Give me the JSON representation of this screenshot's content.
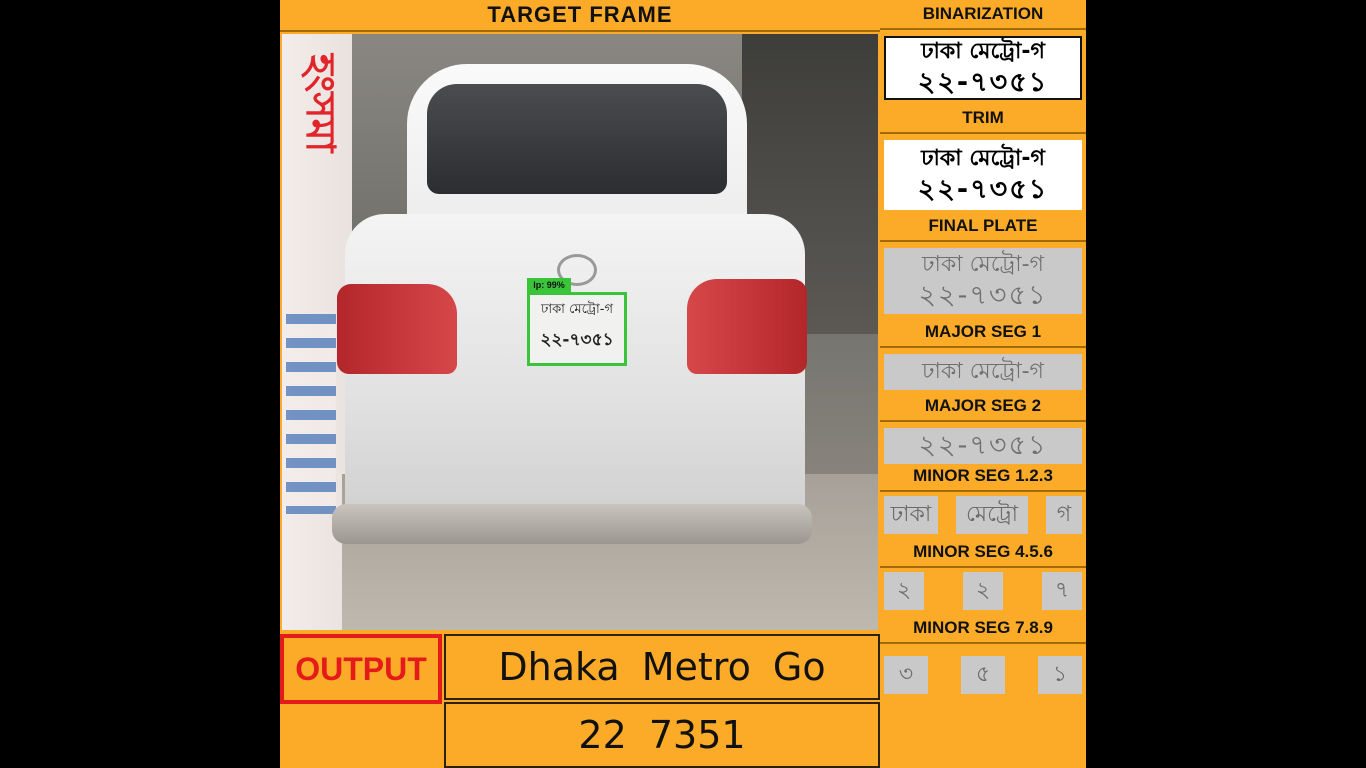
{
  "headers": {
    "target_frame": "TARGET  FRAME",
    "binarization": "BINARIZATION",
    "trim": "TRIM",
    "final_plate": "FINAL PLATE",
    "major_seg_1": "MAJOR SEG 1",
    "major_seg_2": "MAJOR SEG 2",
    "minor_seg_123": "MINOR SEG 1.2.3",
    "minor_seg_456": "MINOR SEG 4.5.6",
    "minor_seg_789": "MINOR SEG 7.8.9"
  },
  "frame": {
    "detect_tag": "lp: 99%",
    "plate_line1": "ঢাকা মেট্রো-গ",
    "plate_line2": "২২-৭৩৫১",
    "wall_text": "হংসমা"
  },
  "plates": {
    "binarization": {
      "line1": "ঢাকা মেট্রো-গ",
      "line2": "২২-৭৩৫১"
    },
    "trim": {
      "line1": "ঢাকা মেট্রো-গ",
      "line2": "২২-৭৩৫১"
    },
    "final": {
      "line1": "ঢাকা মেট্রো-গ",
      "line2": "২২-৭৩৫১"
    },
    "major_seg_1": "ঢাকা মেট্রো-গ",
    "major_seg_2": "২২-৭৩৫১"
  },
  "minor_segments": {
    "seg_123": [
      "ঢাকা",
      "মেট্রো",
      "গ"
    ],
    "seg_456": [
      "২",
      "২",
      "৭"
    ],
    "seg_789": [
      "৩",
      "৫",
      "১"
    ]
  },
  "output": {
    "label": "OUTPUT",
    "line1": "Dhaka  Metro    Go",
    "line2": "22  7351"
  },
  "colors": {
    "background": "#fbab27",
    "output_border": "#e51b1b",
    "detect_box": "#39c43a"
  }
}
